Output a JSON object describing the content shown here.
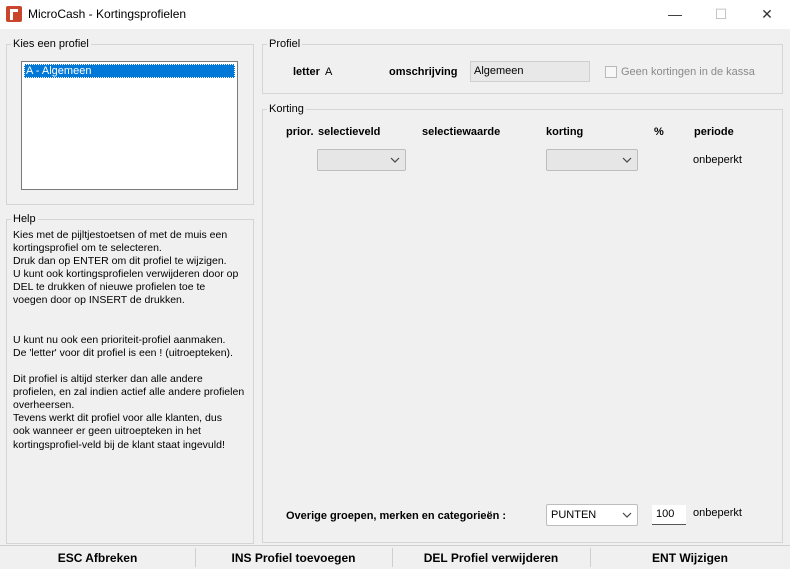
{
  "window": {
    "title": "MicroCash - Kortingsprofielen",
    "minimize_glyph": "—",
    "maximize_glyph": "☐",
    "close_glyph": "✕"
  },
  "profiles": {
    "group_title": "Kies een profiel",
    "items": [
      "A - Algemeen"
    ]
  },
  "help": {
    "group_title": "Help",
    "text": "Kies met de pijltjestoetsen of met de muis een\nkortingsprofiel om te selecteren.\nDruk dan op ENTER om dit profiel te wijzigen.\nU kunt ook kortingsprofielen verwijderen door op\nDEL te drukken of nieuwe profielen toe te\nvoegen door op INSERT de drukken.\n\n\nU kunt nu ook een prioriteit-profiel aanmaken.\nDe 'letter' voor dit profiel is een ! (uitroepteken).\n\nDit profiel is altijd sterker dan alle andere\nprofielen, en zal indien actief alle andere profielen\noverheersen.\nTevens werkt dit profiel voor alle klanten, dus\nook wanneer er geen uitroepteken in het\nkortingsprofiel-veld bij de klant staat ingevuld!"
  },
  "profiel": {
    "group_title": "Profiel",
    "letter_label": "letter",
    "letter_value": "A",
    "omschrijving_label": "omschrijving",
    "omschrijving_value": "Algemeen",
    "checkbox_label": "Geen kortingen in de kassa"
  },
  "korting": {
    "group_title": "Korting",
    "headers": {
      "prior": "prior.",
      "selectieveld": "selectieveld",
      "selectiewaarde": "selectiewaarde",
      "korting": "korting",
      "percent": "%",
      "periode": "periode"
    },
    "row": {
      "selectieveld_value": "",
      "korting_value": "",
      "periode": "onbeperkt"
    },
    "overige": {
      "label": "Overige groepen, merken en categorieën :",
      "combo_value": "PUNTEN",
      "number_value": "100",
      "periode": "onbeperkt"
    }
  },
  "footer": {
    "esc": "ESC Afbreken",
    "ins": "INS Profiel toevoegen",
    "del": "DEL Profiel verwijderen",
    "ent": "ENT Wijzigen"
  }
}
